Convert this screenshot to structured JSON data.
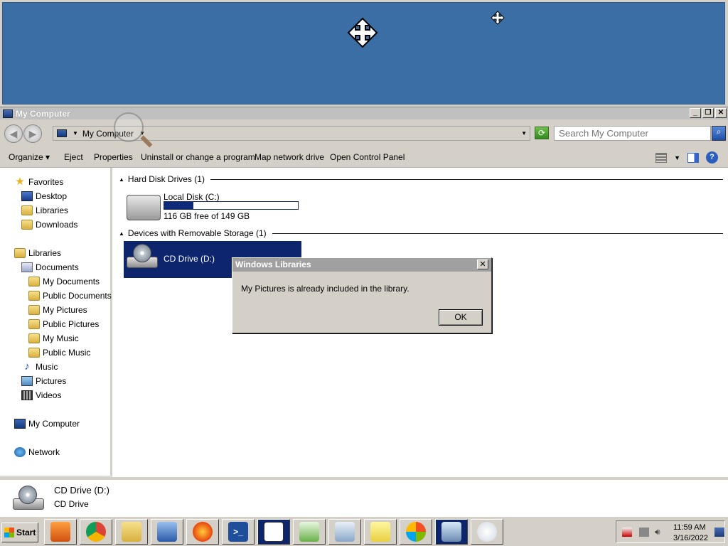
{
  "window": {
    "title": "My Computer",
    "buttons": {
      "minimize": "_",
      "restore": "❐",
      "close": "✕"
    }
  },
  "address_bar": {
    "path": "My Computer",
    "search_placeholder": "Search My Computer",
    "back_icon": "back-arrow-icon",
    "forward_icon": "forward-arrow-icon"
  },
  "toolbar": {
    "organize": "Organize",
    "eject": "Eject",
    "properties": "Properties",
    "uninstall": "Uninstall or change a program",
    "map_drive": "Map network drive",
    "control_panel": "Open Control Panel"
  },
  "sidebar": {
    "favorites": "Favorites",
    "desktop": "Desktop",
    "libraries_fav": "Libraries",
    "downloads": "Downloads",
    "libraries": "Libraries",
    "documents": "Documents",
    "my_documents": "My Documents",
    "public_documents": "Public Documents",
    "my_pictures": "My Pictures",
    "public_pictures": "Public Pictures",
    "my_music": "My Music",
    "public_music": "Public Music",
    "music": "Music",
    "pictures": "Pictures",
    "videos": "Videos",
    "my_computer": "My Computer",
    "network": "Network"
  },
  "content": {
    "hdd_group": "Hard Disk Drives (1)",
    "local_disk_name": "Local Disk (C:)",
    "local_disk_free": "116 GB free of 149 GB",
    "local_disk_used_fraction": 0.22,
    "removable_group": "Devices with Removable Storage (1)",
    "cd_drive_name": "CD Drive (D:)"
  },
  "dialog": {
    "title": "Windows Libraries",
    "message": "My Pictures is already included in the library.",
    "ok": "OK",
    "close": "✕"
  },
  "details": {
    "name": "CD Drive (D:)",
    "type": "CD Drive"
  },
  "taskbar": {
    "start": "Start",
    "time": "11:59 AM",
    "date": "3/16/2022",
    "apps": [
      "media-player-icon",
      "chrome-icon",
      "file-explorer-icon",
      "remote-desktop-icon",
      "firefox-icon",
      "powershell-icon",
      "solitaire-icon",
      "paint-chart-icon",
      "notepad-icon",
      "sticky-notes-icon",
      "windows-logo-icon",
      "calculator-icon",
      "paint-icon"
    ]
  }
}
